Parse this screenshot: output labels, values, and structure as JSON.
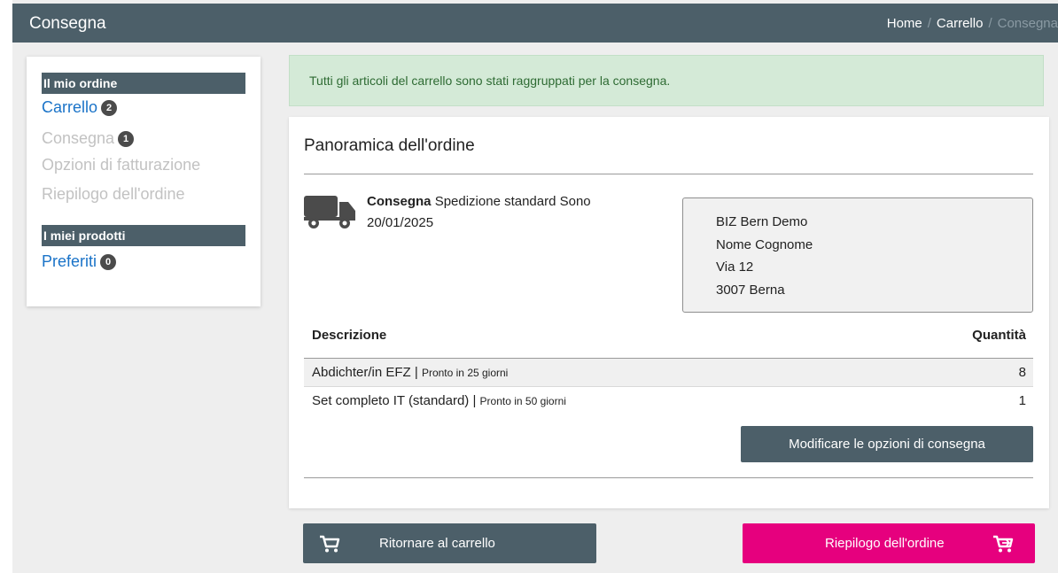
{
  "header": {
    "title": "Consegna",
    "breadcrumb": {
      "home": "Home",
      "sep1": "/",
      "cart": "Carrello",
      "sep2": "/",
      "current": "Consegna"
    }
  },
  "sidebar": {
    "section1": "Il mio ordine",
    "items": [
      {
        "label": "Carrello",
        "badge": "2"
      },
      {
        "label": "Consegna",
        "badge": "1"
      },
      {
        "label": "Opzioni di fatturazione"
      },
      {
        "label": "Riepilogo dell'ordine"
      }
    ],
    "section2": "I miei prodotti",
    "favorites": {
      "label": "Preferiti",
      "badge": "0"
    }
  },
  "alert": {
    "text": "Tutti gli articoli del carrello sono stati raggruppati per la consegna."
  },
  "overview": {
    "title": "Panoramica dell'ordine",
    "delivery": {
      "label": "Consegna",
      "method": "Spedizione standard Sono",
      "date": "20/01/2025"
    },
    "address": {
      "line1": "BIZ Bern Demo",
      "line2": "Nome Cognome",
      "line3": "Via 12",
      "line4": "3007 Berna"
    },
    "table": {
      "col_description": "Descrizione",
      "col_quantity": "Quantità",
      "rows": [
        {
          "name": "Abdichter/in EFZ |",
          "note": "Pronto in 25 giorni",
          "qty": "8"
        },
        {
          "name": "Set completo IT (standard) |",
          "note": "Pronto in 50 giorni",
          "qty": "1"
        }
      ]
    },
    "modify_button": "Modificare le opzioni di consegna"
  },
  "footer": {
    "back_button": "Ritornare al carrello",
    "next_button": "Riepilogo dell'ordine"
  },
  "colors": {
    "primary": "#4c5f69",
    "accent": "#e6007e",
    "link": "#1a73c8",
    "success_bg": "#d4ead7"
  }
}
